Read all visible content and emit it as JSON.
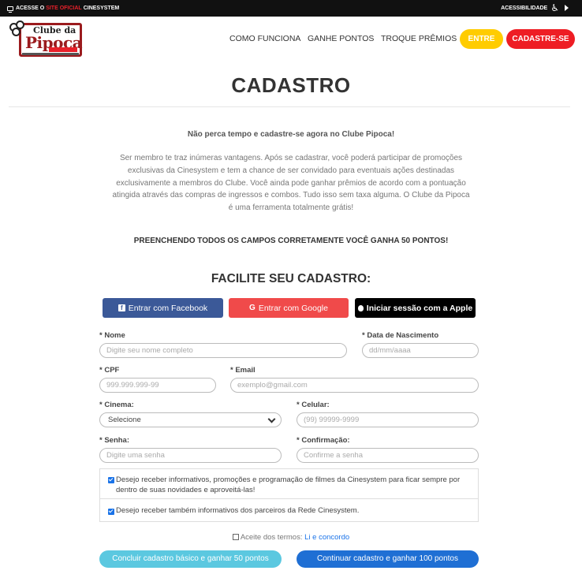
{
  "topbar": {
    "prefix": "ACESSE O",
    "highlight": "SITE OFICIAL",
    "suffix": "CINESYSTEM",
    "accessibility": "ACESSIBILIDADE"
  },
  "logo": {
    "line1": "Clube da",
    "line2": "Pipoca",
    "badge": "CINESYSTEM",
    "tagline": "VOCÊ ASSISTE FILMES NÓS COLECIONAMOS"
  },
  "nav": {
    "items": [
      "COMO FUNCIONA",
      "GANHE PONTOS",
      "TROQUE PRÊMIOS"
    ],
    "entre": "ENTRE",
    "cadastrese": "CADASTRE-SE"
  },
  "page": {
    "title": "CADASTRO",
    "subtitle": "Não perca tempo e cadastre-se agora no Clube Pipoca!",
    "description": "Ser membro te traz inúmeras vantagens. Após se cadastrar, você poderá participar de promoções exclusivas da Cinesystem e tem a chance de ser convidado para eventuais ações destinadas exclusivamente a membros do Clube. Você ainda pode ganhar prêmios de acordo com a pontuação atingida através das compras de ingressos e combos. Tudo isso sem taxa alguma. O Clube da Pipoca é uma ferramenta totalmente grátis!",
    "notice": "PREENCHENDO TODOS OS CAMPOS CORRETAMENTE VOCÊ GANHA 50 PONTOS!",
    "facilite": "FACILITE SEU CADASTRO:"
  },
  "social": {
    "facebook": "Entrar com Facebook",
    "google": "Entrar com Google",
    "apple": "Iniciar sessão com a Apple"
  },
  "form": {
    "nome": {
      "label": "* Nome",
      "placeholder": "Digite seu nome completo"
    },
    "nascimento": {
      "label": "* Data de Nascimento",
      "placeholder": "dd/mm/aaaa"
    },
    "cpf": {
      "label": "* CPF",
      "placeholder": "999.999.999-99"
    },
    "email": {
      "label": "* Email",
      "placeholder": "exemplo@gmail.com"
    },
    "cinema": {
      "label": "* Cinema:",
      "value": "Selecione"
    },
    "celular": {
      "label": "* Celular:",
      "placeholder": "(99) 99999-9999"
    },
    "senha": {
      "label": "* Senha:",
      "placeholder": "Digite uma senha"
    },
    "confirmacao": {
      "label": "* Confirmação:",
      "placeholder": "Confirme a senha"
    }
  },
  "checks": {
    "informativos": "Desejo receber informativos, promoções e programação de filmes da Cinesystem para ficar sempre por dentro de suas novidades e aproveitá-las!",
    "parceiros": "Desejo receber também informativos dos parceiros da Rede Cinesystem."
  },
  "terms": {
    "text": "Aceite dos termos:",
    "link": "Li e concordo"
  },
  "actions": {
    "basic": "Concluir cadastro básico e ganhar 50 pontos",
    "continue": "Continuar cadastro e ganhar 100 pontos"
  },
  "colors": {
    "brand_red": "#ee1d24",
    "brand_yellow": "#ffcc00",
    "facebook": "#3b5998",
    "google": "#f04a4a",
    "apple": "#000000",
    "primary_blue": "#1f6fd4",
    "light_blue": "#5bc8e0"
  }
}
